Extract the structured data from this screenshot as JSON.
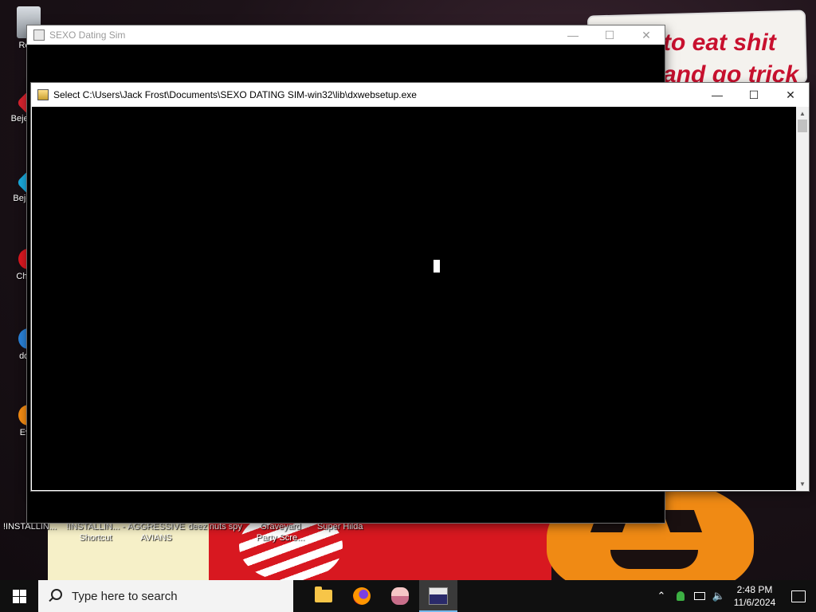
{
  "desktop": {
    "wallpaper_text": [
      "to eat shit",
      "and go trick"
    ],
    "icons_left": [
      {
        "label": "Recy"
      },
      {
        "label": "Bejev De"
      },
      {
        "label": "Beje De"
      },
      {
        "label": "Ch De"
      },
      {
        "label": "does"
      },
      {
        "label": "Ever"
      }
    ],
    "icons_bottom": [
      {
        "label": "!INSTALLIN..."
      },
      {
        "label": "!INSTALLIN... - Shortcut"
      },
      {
        "label": "AGGRESSIVE AVIANS"
      },
      {
        "label": "deez nuts spy"
      },
      {
        "label": "Graveyard Party Scre..."
      },
      {
        "label": "Super Hilda"
      }
    ]
  },
  "windows": {
    "back": {
      "title": "SEXO Dating Sim"
    },
    "front": {
      "title": "Select C:\\Users\\Jack Frost\\Documents\\SEXO DATING SIM-win32\\lib\\dxwebsetup.exe"
    }
  },
  "taskbar": {
    "search_placeholder": "Type here to search",
    "clock_time": "2:48 PM",
    "clock_date": "11/6/2024"
  },
  "colors": {
    "console_bg": "#000000",
    "taskbar_bg": "#101010",
    "accent": "#76b9ed"
  }
}
